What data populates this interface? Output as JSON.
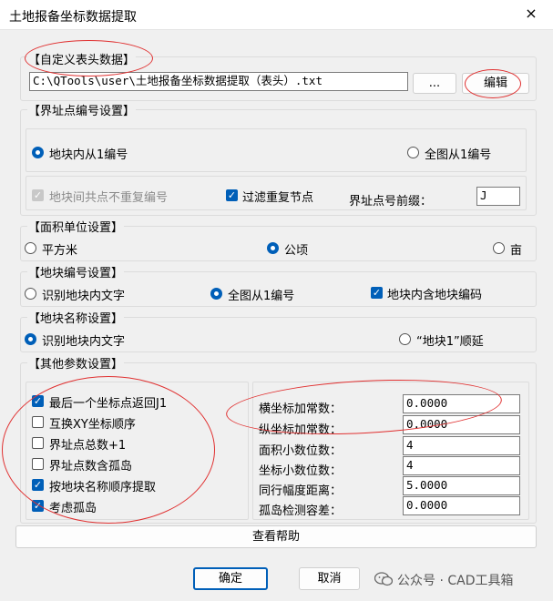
{
  "window": {
    "title": "土地报备坐标数据提取",
    "close_icon": "×"
  },
  "header_group": {
    "legend": "【自定义表头数据】",
    "path_value": "C:\\QTools\\user\\土地报备坐标数据提取（表头）.txt",
    "browse_label": "...",
    "edit_label": "编辑"
  },
  "boundary_group": {
    "legend": "【界址点编号设置】",
    "radio_block": "地块内从1编号",
    "radio_global": "全图从1编号",
    "check_shared": "地块间共点不重复编号",
    "check_filter": "过滤重复节点",
    "prefix_label": "界址点号前缀：",
    "prefix_value": "J"
  },
  "area_group": {
    "legend": "【面积单位设置】",
    "opt1": "平方米",
    "opt2": "公顷",
    "opt3": "亩"
  },
  "block_no_group": {
    "legend": "【地块编号设置】",
    "opt1": "识别地块内文字",
    "opt2": "全图从1编号",
    "check": "地块内含地块编码"
  },
  "block_name_group": {
    "legend": "【地块名称设置】",
    "opt1": "识别地块内文字",
    "opt2": "“地块1”顺延"
  },
  "other_group": {
    "legend": "【其他参数设置】",
    "checks": [
      {
        "label": "最后一个坐标点返回J1",
        "checked": true
      },
      {
        "label": "互换XY坐标顺序",
        "checked": false
      },
      {
        "label": "界址点总数+1",
        "checked": false
      },
      {
        "label": "界址点数含孤岛",
        "checked": false
      },
      {
        "label": "按地块名称顺序提取",
        "checked": true
      },
      {
        "label": "考虑孤岛",
        "checked": true
      }
    ],
    "params": [
      {
        "label": "横坐标加常数：",
        "value": "0.0000"
      },
      {
        "label": "纵坐标加常数：",
        "value": "0.0000"
      },
      {
        "label": "面积小数位数：",
        "value": "4"
      },
      {
        "label": "坐标小数位数：",
        "value": "4"
      },
      {
        "label": "同行幅度距离：",
        "value": "5.0000"
      },
      {
        "label": "孤岛检测容差：",
        "value": "0.0000"
      }
    ]
  },
  "help_label": "查看帮助",
  "ok_label": "确定",
  "cancel_label": "取消",
  "watermark": "公众号 · CAD工具箱",
  "colors": {
    "accent": "#005fb8",
    "annotation": "#e03030"
  }
}
